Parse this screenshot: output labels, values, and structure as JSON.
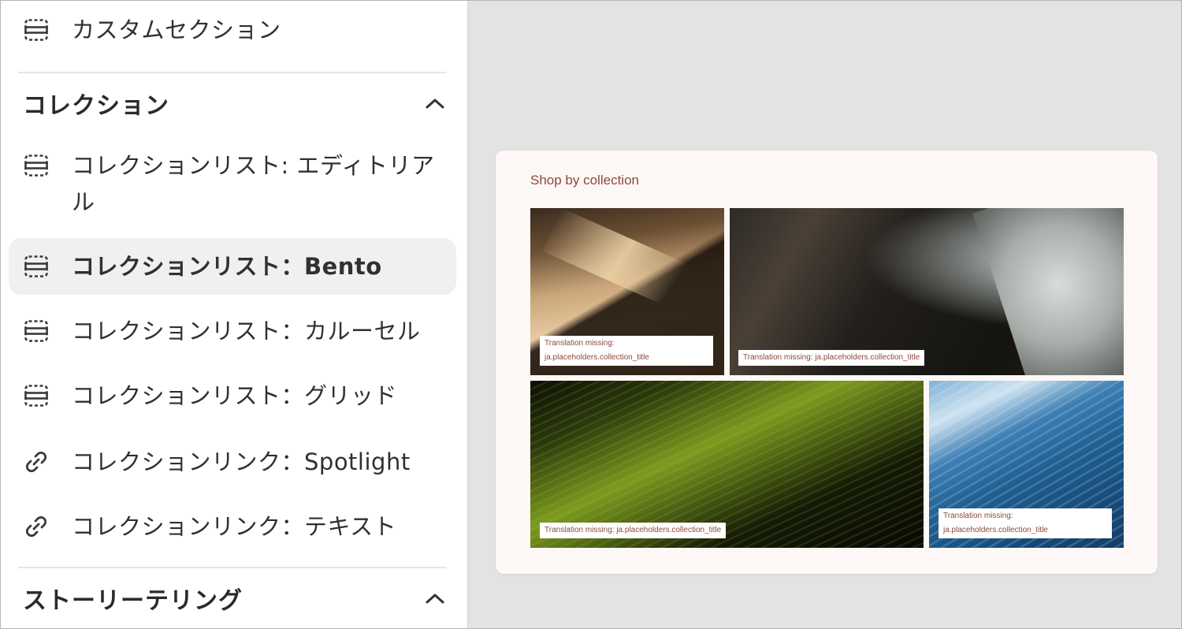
{
  "sidebar": {
    "top_item": {
      "label": "カスタムセクション",
      "icon": "section-icon"
    },
    "groups": [
      {
        "title": "コレクション",
        "expanded": true,
        "items": [
          {
            "label": "コレクションリスト: エディトリアル",
            "icon": "section-icon"
          },
          {
            "label": "コレクションリスト：Bento",
            "icon": "section-icon",
            "selected": true
          },
          {
            "label": "コレクションリスト：カルーセル",
            "icon": "section-icon"
          },
          {
            "label": "コレクションリスト：グリッド",
            "icon": "section-icon"
          },
          {
            "label": "コレクションリンク：Spotlight",
            "icon": "link-icon"
          },
          {
            "label": "コレクションリンク：テキスト",
            "icon": "link-icon"
          }
        ]
      },
      {
        "title": "ストーリーテリング",
        "expanded": true,
        "items": []
      }
    ]
  },
  "preview": {
    "heading": "Shop by collection",
    "tiles": [
      {
        "caption_line1": "Translation missing:",
        "caption_line2": "ja.placeholders.collection_title",
        "image": "desert-dunes"
      },
      {
        "caption_line1": "Translation missing: ja.placeholders.collection_title",
        "caption_line2": "",
        "image": "ocean-shore"
      },
      {
        "caption_line1": "Translation missing: ja.placeholders.collection_title",
        "caption_line2": "",
        "image": "green-grass"
      },
      {
        "caption_line1": "Translation missing:",
        "caption_line2": "ja.placeholders.collection_title",
        "image": "blue-water"
      }
    ]
  },
  "colors": {
    "sidebar_bg": "#ffffff",
    "canvas_bg": "#e3e3e3",
    "selected_bg": "#f0f0f0",
    "card_bg": "#fdf8f5",
    "accent_text": "#8a4a3c"
  }
}
